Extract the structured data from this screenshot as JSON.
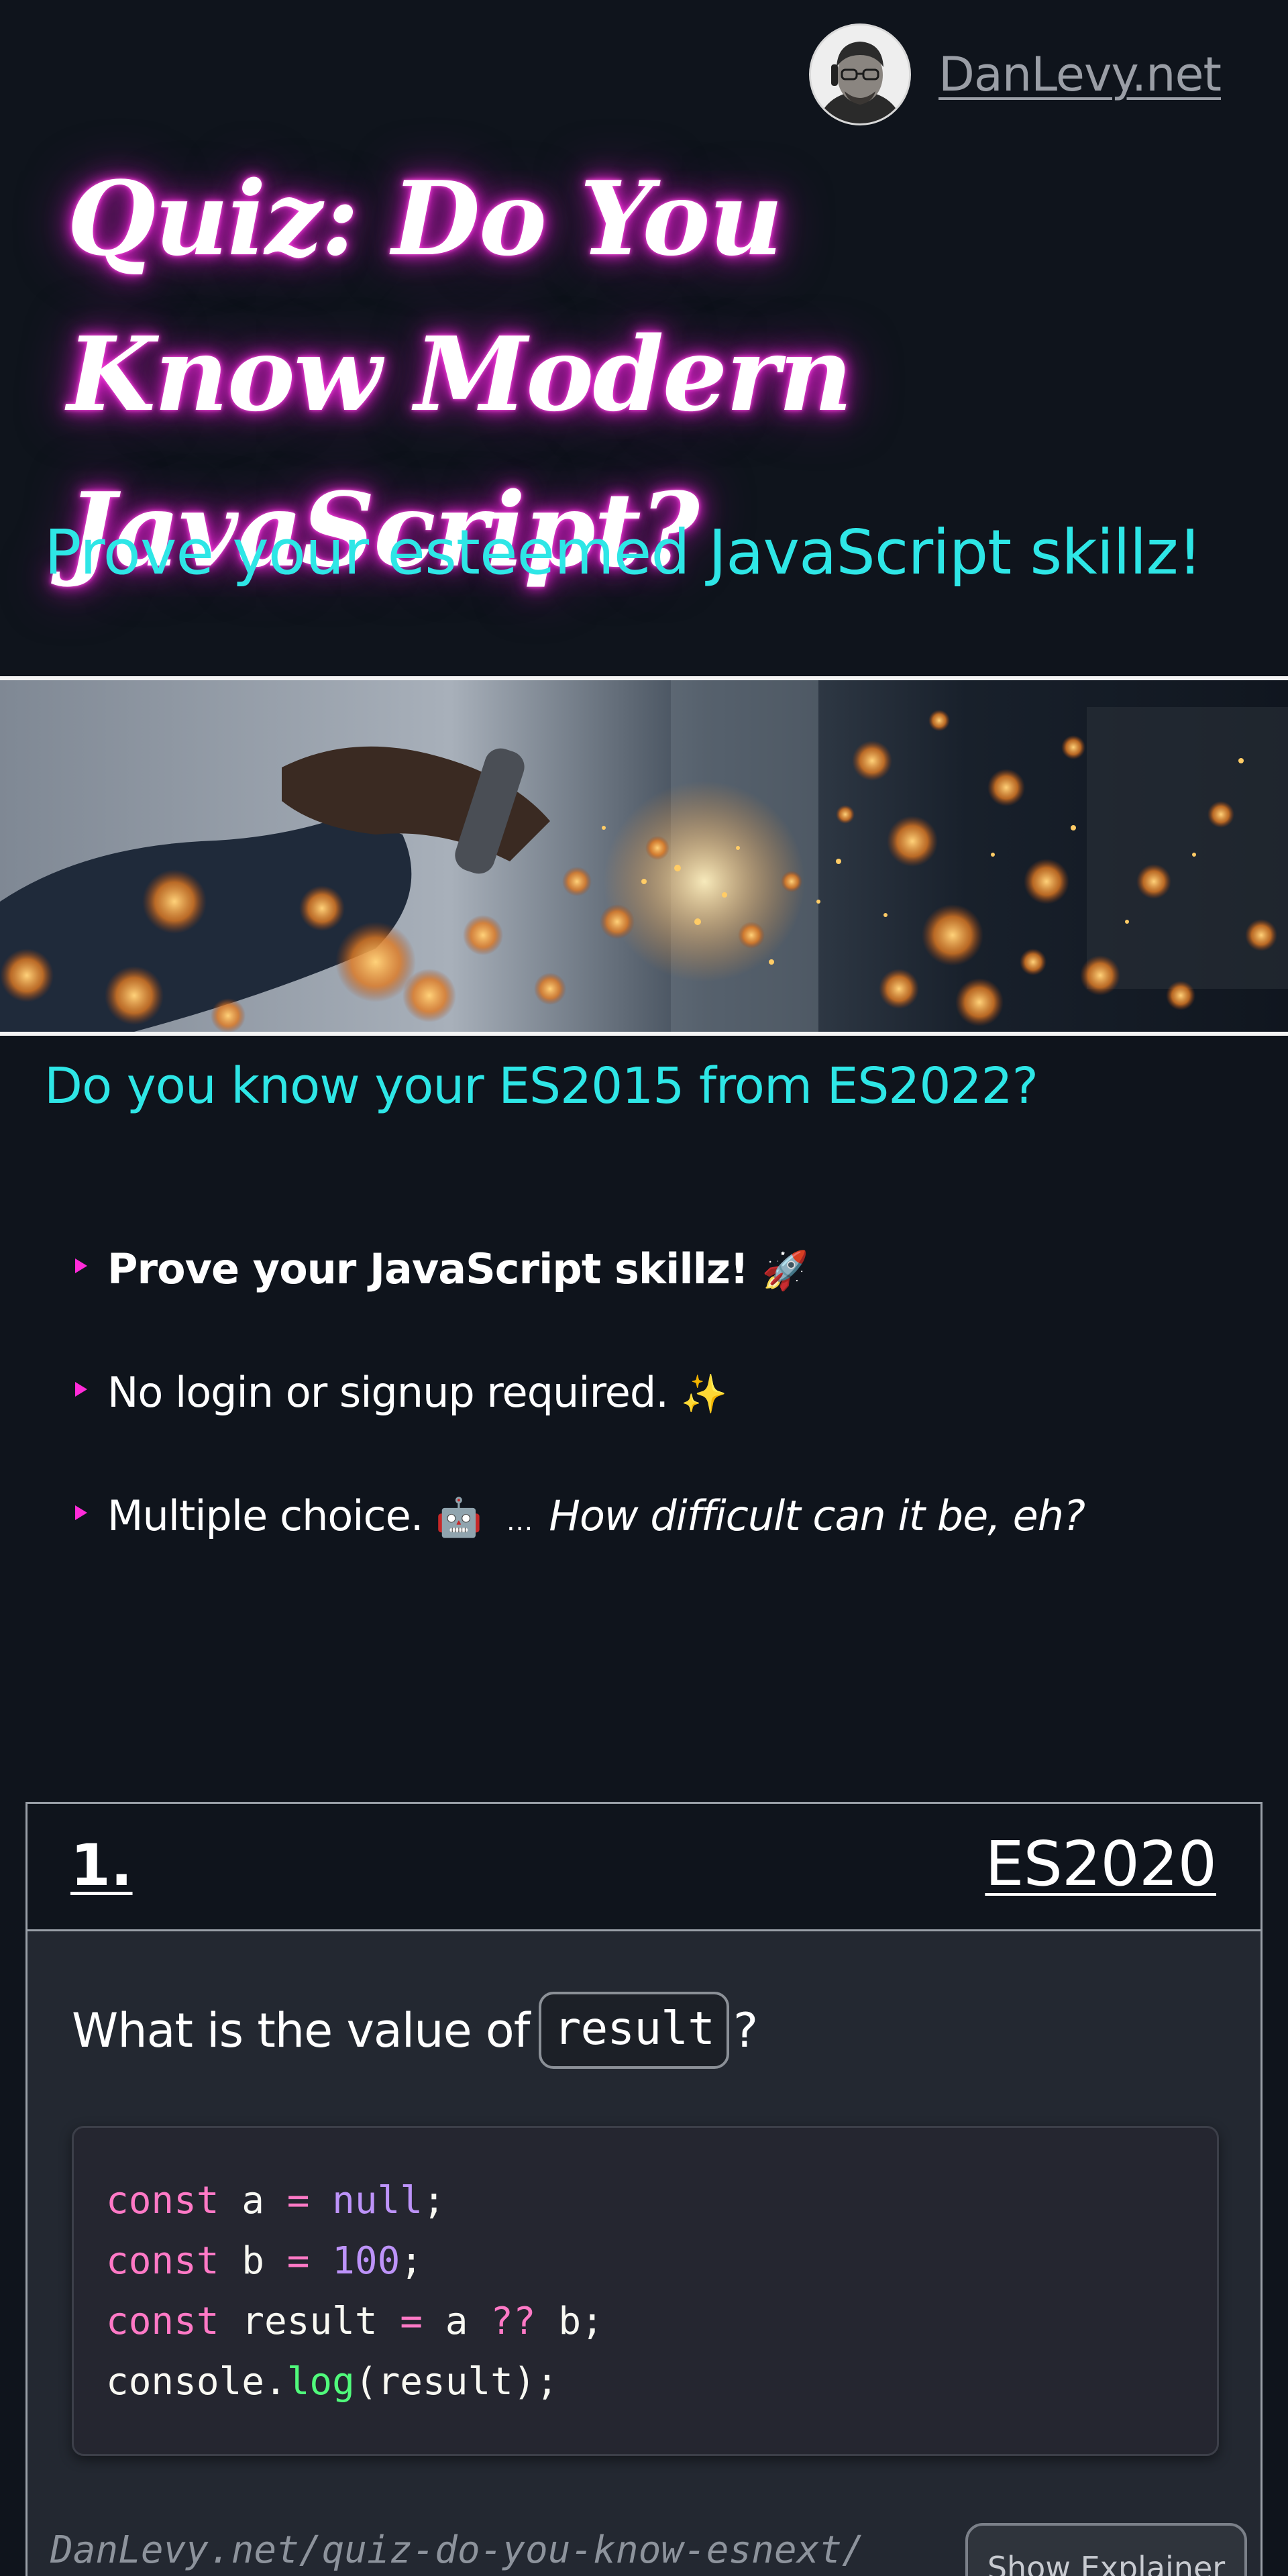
{
  "header": {
    "site_link": "DanLevy.net",
    "avatar_icon": "author-avatar"
  },
  "hero": {
    "title": "Quiz: Do You Know Modern JavaScript?",
    "subtitle": "Prove your esteemed JavaScript skillz!"
  },
  "intro": {
    "heading": "Do you know your ES2015 from ES2022?",
    "features": [
      {
        "text": "Prove your JavaScript skillz!",
        "emoji": "🚀"
      },
      {
        "text": "No login or signup required.",
        "emoji": "✨"
      },
      {
        "text": "Multiple choice.",
        "emoji": "🤖",
        "aside_prefix": "…",
        "aside": "How difficult can it be, eh?"
      }
    ]
  },
  "quiz": {
    "question_number": "1.",
    "tag": "ES2020",
    "prompt_before": "What is the value of",
    "prompt_code": "result",
    "prompt_after": "?",
    "code_lines": [
      "const a = null;",
      "const b = 100;",
      "const result = a ?? b;",
      "console.log(result);"
    ],
    "footer_url": "DanLevy.net/quiz-do-you-know-esnext/",
    "explainer_button": "Show Explainer"
  },
  "colors": {
    "background": "#0f141c",
    "accent_cyan": "#2ee6e6",
    "accent_magenta": "#ff2bd8",
    "card": "#232831"
  }
}
